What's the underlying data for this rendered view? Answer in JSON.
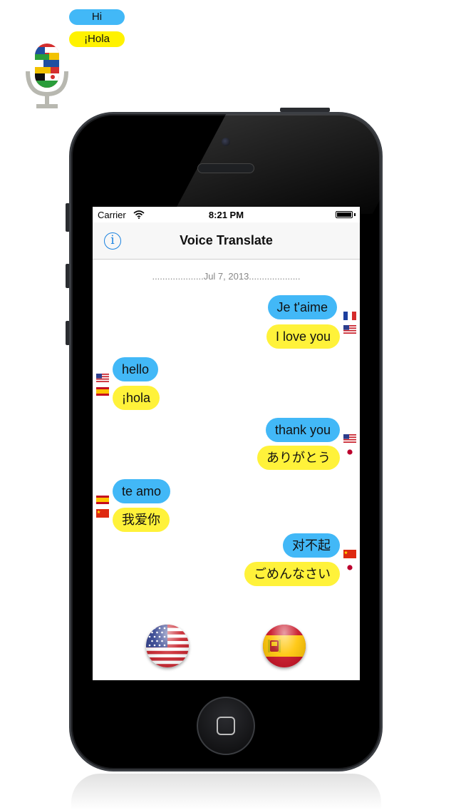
{
  "logo": {
    "bubble_top": "Hi",
    "bubble_bottom": "¡Hola"
  },
  "status_bar": {
    "carrier": "Carrier",
    "time": "8:21 PM"
  },
  "nav": {
    "title": "Voice Translate",
    "info_glyph": "i"
  },
  "date_separator": "....................Jul 7, 2013....................",
  "colors": {
    "blue_bubble": "#42b8f7",
    "yellow_bubble": "#fff23a",
    "accent": "#1a82e0"
  },
  "messages": [
    {
      "side": "right",
      "original": "Je t'aime",
      "translation": "I love you",
      "from_flag": "france-flag-icon",
      "to_flag": "usa-flag-icon"
    },
    {
      "side": "left",
      "original": "hello",
      "translation": "¡hola",
      "from_flag": "usa-flag-icon",
      "to_flag": "spain-flag-icon"
    },
    {
      "side": "right",
      "original": "thank you",
      "translation": "ありがとう",
      "from_flag": "usa-flag-icon",
      "to_flag": "japan-flag-icon"
    },
    {
      "side": "left",
      "original": "te amo",
      "translation": "我爱你",
      "from_flag": "spain-flag-icon",
      "to_flag": "china-flag-icon"
    },
    {
      "side": "right",
      "original": "对不起",
      "translation": "ごめんなさい",
      "from_flag": "china-flag-icon",
      "to_flag": "japan-flag-icon"
    }
  ],
  "language_buttons": [
    {
      "name": "english-language-button",
      "icon": "usa-flag-icon"
    },
    {
      "name": "spanish-language-button",
      "icon": "spain-flag-icon"
    }
  ]
}
